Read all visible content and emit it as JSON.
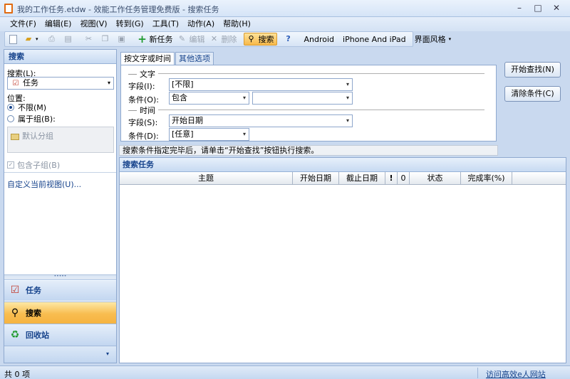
{
  "window": {
    "title": "我的工作任务.etdw - 效能工作任务管理免费版 - 搜索任务",
    "minimize": "–",
    "maximize": "□",
    "close": "✕"
  },
  "menu": [
    "文件(F)",
    "编辑(E)",
    "视图(V)",
    "转到(G)",
    "工具(T)",
    "动作(A)",
    "帮助(H)"
  ],
  "toolbar": {
    "new_task": "新任务",
    "edit": "编辑",
    "delete": "删除",
    "search": "搜索",
    "android": "Android",
    "iphone": "iPhone And iPad",
    "theme": "界面风格"
  },
  "sidebar": {
    "header": "搜索",
    "search_label": "搜索(L):",
    "search_value": "任务",
    "location_label": "位置:",
    "opt_unlimited": "不限(M)",
    "opt_group": "属于组(B):",
    "default_group": "默认分组",
    "include_sub": "包含子组(B)",
    "custom_view": "自定义当前视图(U)...",
    "nav_tasks": "任务",
    "nav_search": "搜索",
    "nav_recycle": "回收站",
    "nav_more": "▾"
  },
  "main": {
    "tab_text_time": "按文字或时间",
    "tab_other": "其他选项",
    "group_text": "文字",
    "field_label_1": "字段(I):",
    "field_value_1": "[不限]",
    "cond_label_1": "条件(O):",
    "cond_value_1": "包含",
    "cond_text_1": "",
    "group_time": "时间",
    "field_label_2": "字段(S):",
    "field_value_2": "开始日期",
    "cond_label_2": "条件(D):",
    "cond_value_2": "[任意]",
    "btn_start": "开始查找(N)",
    "btn_clear": "清除条件(C)",
    "hint": "搜索条件指定完毕后，请单击“开始查找”按钮执行搜索。",
    "results_title": "搜索任务",
    "columns": [
      "主题",
      "开始日期",
      "截止日期",
      "!",
      "0",
      "状态",
      "完成率(%)"
    ]
  },
  "status": {
    "count": "共 0 项",
    "link": "访问高效e人网站"
  }
}
